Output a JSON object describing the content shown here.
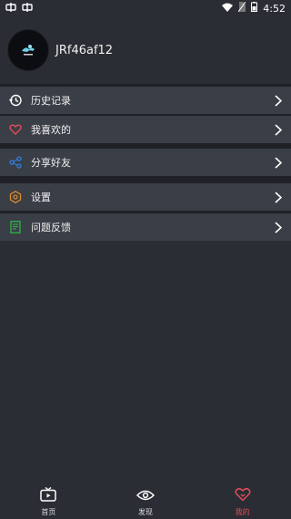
{
  "status": {
    "time": "4:52"
  },
  "profile": {
    "username": "JRf46af12"
  },
  "menu": {
    "history": {
      "label": "历史记录"
    },
    "favorites": {
      "label": "我喜欢的"
    },
    "share": {
      "label": "分享好友"
    },
    "settings": {
      "label": "设置"
    },
    "feedback": {
      "label": "问题反馈"
    }
  },
  "nav": [
    {
      "label": "首页"
    },
    {
      "label": "发现"
    },
    {
      "label": "我的"
    }
  ],
  "colors": {
    "background": "#2a2d33",
    "item_bg": "#3a3e46",
    "accent": "#e04c5a",
    "share_icon": "#2f7fe0",
    "settings_icon": "#e08a2f",
    "feedback_icon": "#2fb34a"
  }
}
